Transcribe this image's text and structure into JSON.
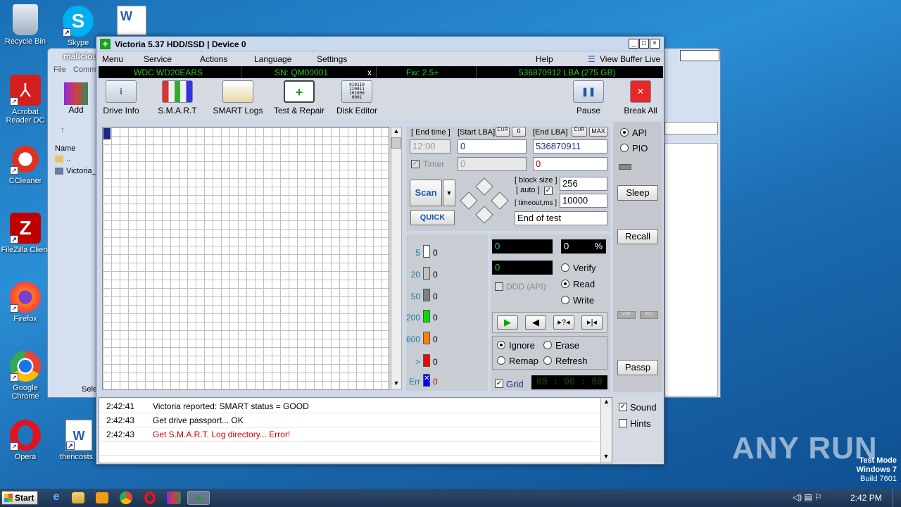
{
  "desktop_icons": [
    {
      "name": "Recycle Bin"
    },
    {
      "name": "Skype"
    },
    {
      "name": "Acrobat Reader DC"
    },
    {
      "name": "CCleaner"
    },
    {
      "name": "FileZilla Client"
    },
    {
      "name": "Firefox"
    },
    {
      "name": "Google Chrome"
    },
    {
      "name": "Opera"
    },
    {
      "name": "thencosts.r"
    }
  ],
  "bg_window": {
    "title": "maliciou",
    "menu": [
      "File",
      "Comma"
    ],
    "add_label": "Add",
    "col_name": "Name",
    "rows": [
      "..",
      "Victoria_"
    ],
    "status": "Sele"
  },
  "window": {
    "title": "Victoria 5.37 HDD/SSD | Device 0"
  },
  "menu": {
    "items": [
      "Menu",
      "Service",
      "Actions",
      "Language",
      "Settings",
      "Help"
    ],
    "view_buffer": "View Buffer Live"
  },
  "info": {
    "model": "WDC WD20EARS",
    "serial": "SN: QM00001",
    "x": "x",
    "firmware": "Fw: 2.5+",
    "lba": "536870912 LBA (275 GB)"
  },
  "toolbar": {
    "drive_info": "Drive Info",
    "smart": "S.M.A.R.T",
    "smart_logs": "SMART Logs",
    "test_repair": "Test & Repair",
    "disk_editor": "Disk Editor",
    "pause": "Pause",
    "break_all": "Break All"
  },
  "scan": {
    "end_time_label": "[ End time ]",
    "start_lba_label": "[Start LBA]",
    "cur": "CUR",
    "zero": "0",
    "end_lba_label": "[End LBA]",
    "cur2": "CUR",
    "max": "MAX",
    "end_time": "12:00",
    "start_lba": "0",
    "end_lba": "536870911",
    "timer_label": "Timer",
    "timer_value": "0",
    "end_value": "0",
    "scan_btn": "Scan",
    "quick_btn": "QUICK",
    "block_size_label": "[ block size ]",
    "auto_label": "[ auto ]",
    "block_size": "256",
    "timeout_label": "[ timeout,ms ]",
    "timeout": "10000",
    "end_action": "End of test"
  },
  "legend": [
    {
      "ms": "5",
      "count": "0",
      "color": "#ffffff"
    },
    {
      "ms": "20",
      "count": "0",
      "color": "#c0c0c0"
    },
    {
      "ms": "50",
      "count": "0",
      "color": "#808080"
    },
    {
      "ms": "200",
      "count": "0",
      "color": "#00e000"
    },
    {
      "ms": "600",
      "count": "0",
      "color": "#ff8000"
    },
    {
      "ms": ">",
      "count": "0",
      "color": "#ff0000"
    },
    {
      "ms": "Err",
      "count": "0",
      "color": "#0000ff"
    }
  ],
  "stats": {
    "value1": "0",
    "percent": "0",
    "percent_sign": "%",
    "value2": "0",
    "ddd": "DDD (API)",
    "verify": "Verify",
    "read": "Read",
    "write": "Write",
    "ignore": "Ignore",
    "erase": "Erase",
    "remap": "Remap",
    "refresh": "Refresh",
    "grid": "Grid",
    "timer_display": "00 : 00 : 00"
  },
  "side": {
    "api": "API",
    "pio": "PIO",
    "sleep": "Sleep",
    "recall": "Recall",
    "wr": "WR",
    "rd": "RD",
    "passp": "Passp",
    "sound": "Sound",
    "hints": "Hints"
  },
  "log": [
    {
      "time": "2:42:41",
      "msg": "Victoria reported: SMART status = GOOD",
      "color": "#000000"
    },
    {
      "time": "2:42:43",
      "msg": "Get drive passport... OK",
      "color": "#000000"
    },
    {
      "time": "2:42:43",
      "msg": "Get S.M.A.R.T. Log directory... Error!",
      "color": "#d00000"
    }
  ],
  "watermark": {
    "brand": "ANY RUN",
    "test_mode": "Test Mode",
    "os": "Windows 7",
    "build": "Build 7601"
  },
  "taskbar": {
    "start": "Start",
    "clock": "2:42 PM"
  }
}
